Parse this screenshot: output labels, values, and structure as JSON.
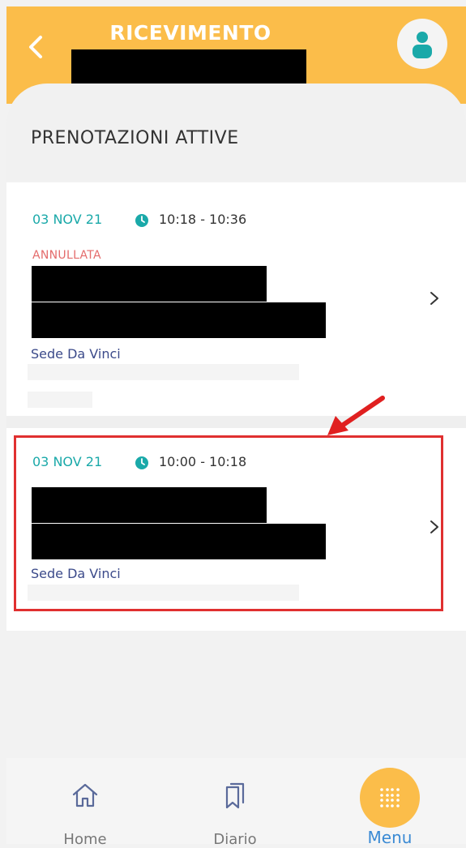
{
  "header": {
    "title": "RICEVIMENTO"
  },
  "section_title": "PRENOTAZIONI ATTIVE",
  "bookings": [
    {
      "date": "03 NOV 21",
      "time": "10:18 - 10:36",
      "status": "ANNULLATA",
      "location": "Sede Da Vinci"
    },
    {
      "date": "03 NOV 21",
      "time": "10:00 - 10:18",
      "status": "",
      "location": "Sede Da Vinci"
    }
  ],
  "nav": {
    "home": "Home",
    "diario": "Diario",
    "menu": "Menu"
  },
  "colors": {
    "accent": "#fbbd4a",
    "teal": "#1aa9a9",
    "cancelled": "#e46c6c",
    "highlight": "#e03030"
  },
  "icons": [
    "back-icon",
    "profile-icon",
    "clock-icon",
    "chevron-right-icon",
    "home-icon",
    "diary-icon",
    "menu-grid-icon"
  ]
}
